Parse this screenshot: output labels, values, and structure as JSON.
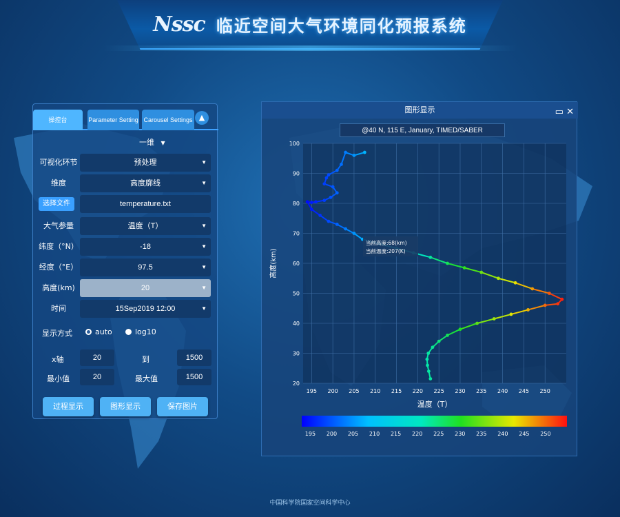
{
  "header": {
    "logo": "Nssc",
    "title": "临近空间大气环境同化预报系统"
  },
  "panel": {
    "tabs": [
      {
        "label": "操控台"
      },
      {
        "label": "Parameter Setting"
      },
      {
        "label": "Carousel Settings"
      }
    ],
    "dimension_select": "一维",
    "rows": [
      {
        "label": "可视化环节",
        "value": "预处理"
      },
      {
        "label": "维度",
        "value": "高度廓线"
      },
      {
        "label": "选择文件",
        "value": "temperature.txt"
      },
      {
        "label": "大气参量",
        "value": "温度（T）"
      },
      {
        "label": "纬度（°N）",
        "value": "-18"
      },
      {
        "label": "经度（°E）",
        "value": "97.5"
      },
      {
        "label": "高度(km)",
        "value": "20"
      },
      {
        "label": "时间",
        "value": "15Sep2019 12:00"
      }
    ],
    "display_mode": {
      "label": "显示方式",
      "options": [
        "auto",
        "log10"
      ],
      "selected": "auto"
    },
    "x_axis": {
      "label": "x轴",
      "from": "20",
      "to_label": "到",
      "to": "1500"
    },
    "min_max": {
      "min_label": "最小值",
      "min": "20",
      "max_label": "最大值",
      "max": "1500"
    },
    "buttons": {
      "process": "过程显示",
      "graph": "图形显示",
      "save": "保存图片"
    }
  },
  "window": {
    "title": "图形显示",
    "subtitle": "@40 N, 115 E, January, TIMED/SABER",
    "tooltip": {
      "height": "当前高度:68(km)",
      "temp": "当前温度:207(K)"
    }
  },
  "chart_data": {
    "type": "line",
    "xlabel": "温度（T）",
    "ylabel": "高度(km)",
    "xlim": [
      193,
      255
    ],
    "ylim": [
      20,
      100
    ],
    "xticks": [
      195,
      200,
      205,
      210,
      215,
      220,
      225,
      230,
      235,
      240,
      245,
      250
    ],
    "yticks": [
      20,
      30,
      40,
      50,
      60,
      70,
      80,
      90,
      100
    ],
    "colorbar_ticks": [
      195,
      200,
      205,
      210,
      215,
      220,
      225,
      230,
      235,
      240,
      245,
      250
    ],
    "colorbar_range": [
      193,
      255
    ],
    "x": [
      207.5,
      205,
      203,
      202,
      201,
      199,
      198.5,
      198,
      200,
      201,
      199.5,
      198,
      196,
      195,
      194,
      195,
      197,
      199,
      201,
      203,
      205,
      207,
      211,
      215,
      219,
      223,
      227,
      231,
      235,
      239,
      243,
      247,
      251,
      254,
      253,
      250,
      246,
      242,
      238,
      234,
      230,
      227,
      225,
      223.5,
      222.5,
      222.2,
      222.3,
      222.6,
      223
    ],
    "y": [
      97,
      96,
      97,
      93,
      91,
      89.5,
      88.5,
      86.5,
      85.5,
      83.5,
      82,
      81,
      80.5,
      80.3,
      80.5,
      78,
      76,
      74,
      73,
      71.5,
      70,
      68,
      66.5,
      65,
      63.5,
      62,
      60,
      58.5,
      57,
      55,
      53.5,
      51.5,
      50,
      48,
      46.5,
      46,
      44.5,
      43,
      41.5,
      40,
      38,
      36,
      34,
      32,
      30,
      28,
      26,
      24,
      21.5
    ]
  },
  "footer": "中国科学院国家空间科学中心"
}
